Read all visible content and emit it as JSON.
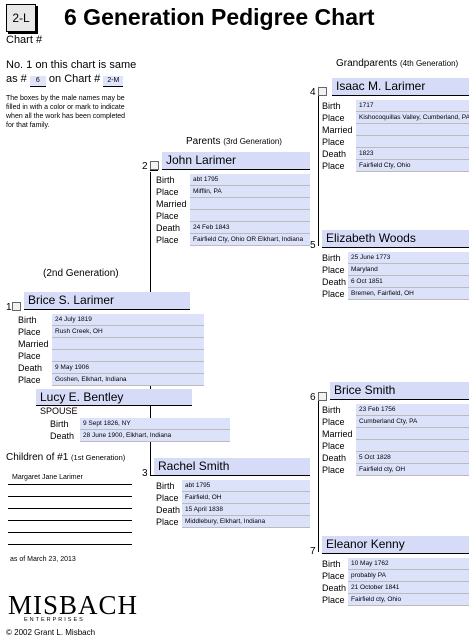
{
  "header": {
    "chart_number": "2-L",
    "chart_label": "Chart #",
    "title": "6 Generation Pedigree Chart",
    "line1": "No. 1 on this chart is same",
    "as_prefix": "as #",
    "as_value": "6",
    "on_chart": "on Chart #",
    "chart_ref": "2-M",
    "note": "The boxes by the male names may be filled in with a color or mark to indicate when all the work has been completed for that family."
  },
  "labels": {
    "birth": "Birth",
    "place": "Place",
    "married": "Married",
    "death": "Death",
    "spouse": "SPOUSE",
    "gen2": "(2nd Generation)",
    "parents": "Parents",
    "parents_gen": "(3rd Generation)",
    "grandparents": "Grandparents",
    "grandparents_gen": "(4th Generation)",
    "children": "Children of #1",
    "children_gen": "(1st Generation)"
  },
  "persons": {
    "p1": {
      "number": "1",
      "name": "Brice S. Larimer",
      "birth": "24 July 1819",
      "birth_place": "Rush Creek, OH",
      "married": "",
      "married_place": "",
      "death": "9 May 1906",
      "death_place": "Goshen, Elkhart, Indiana"
    },
    "spouse": {
      "name": "Lucy E. Bentley",
      "birth": "9 Sept 1826, NY",
      "death": "28 June 1900, Elkhart, Indiana"
    },
    "p2": {
      "number": "2",
      "name": "John Larimer",
      "birth": "abt 1795",
      "birth_place": "Mifflin, PA",
      "married": "",
      "married_place": "",
      "death": "24 Feb 1843",
      "death_place": "Fairfield Cty, Ohio OR Elkhart, Indiana"
    },
    "p3": {
      "number": "3",
      "name": "Rachel Smith",
      "birth": "abt 1795",
      "birth_place": "Fairfield, OH",
      "death": "15 April 1838",
      "death_place": "Middlebury, Elkhart, Indiana"
    },
    "p4": {
      "number": "4",
      "name": "Isaac M. Larimer",
      "birth": "1717",
      "birth_place": "Kishocoquillas Valley, Cumberland, PA",
      "married": "",
      "married_place": "",
      "death": "1823",
      "death_place": "Fairfield Cty, Ohio"
    },
    "p5": {
      "number": "5",
      "name": "Elizabeth Woods",
      "birth": "25 June 1773",
      "birth_place": "Maryland",
      "death": "6 Oct 1851",
      "death_place": "Bremen, Fairfield, OH"
    },
    "p6": {
      "number": "6",
      "name": "Brice Smith",
      "birth": "23 Feb 1756",
      "birth_place": "Cumberland Cty, PA",
      "married": "",
      "married_place": "",
      "death": "5 Oct 1828",
      "death_place": "Fairfield cty, OH"
    },
    "p7": {
      "number": "7",
      "name": "Eleanor Kenny",
      "birth": "10 May 1762",
      "birth_place": "probably PA",
      "death": "21 October 1841",
      "death_place": "Fairfield cty, Ohio"
    }
  },
  "children": {
    "list": [
      "Margaret Jane Larimer",
      "",
      "",
      "",
      "",
      ""
    ],
    "as_of": "as of March 23, 2013"
  },
  "footer": {
    "logo": "MISBACH",
    "logo_sub": "ENTERPRISES",
    "copyright": "© 2002 Grant L. Misbach"
  }
}
